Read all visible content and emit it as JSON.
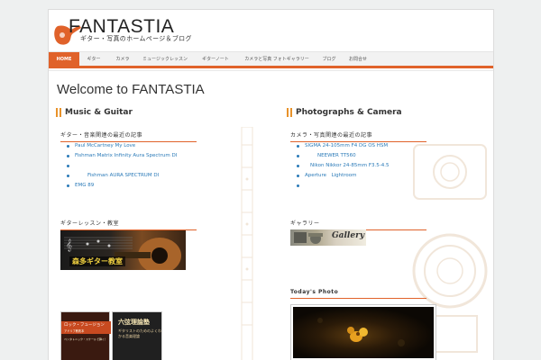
{
  "site": {
    "title": "FANTASTIA",
    "tagline": "ギター・写真のホームページ＆ブログ"
  },
  "nav": {
    "items": [
      {
        "label": "HOME",
        "active": true
      },
      {
        "label": "ギター",
        "active": false
      },
      {
        "label": "カメラ",
        "active": false
      },
      {
        "label": "ミュージックレッスン",
        "active": false
      },
      {
        "label": "ギターノート",
        "active": false
      },
      {
        "label": "カメラと写真 フォトギャラリー",
        "active": false
      },
      {
        "label": "ブログ",
        "active": false
      },
      {
        "label": "お問合せ",
        "active": false
      }
    ]
  },
  "welcome": "Welcome to FANTASTIA",
  "music": {
    "title": "Music & Guitar",
    "widget_title": "ギター・音楽関連の最近の記事",
    "links": [
      "Paul McCartney My Love",
      "Fishman Matrix Infinity Aura Spectrum DI",
      "",
      "Fishman AURA SPECTRUM DI",
      "EMG 89"
    ],
    "lesson_widget_title": "ギターレッスン・教室",
    "lesson_banner": "森多ギター教室"
  },
  "photo": {
    "title": "Photographs & Camera",
    "widget_title": "カメラ・写真関連の最近の記事",
    "links": [
      "SIGMA 24-105mm F4 DG OS HSM",
      "NEEWER TT560",
      "Nikon Nikkor 24-85mm F3.5-4.5",
      "Aperture　Lightroom",
      ""
    ],
    "gallery_widget_title": "ギャラリー",
    "gallery_label": "Gallery",
    "today_title": "Today's Photo"
  },
  "books": {
    "book1_title": "ロック・フュージョン",
    "book1_sub": "アドリブ教則本",
    "book1_caption": "ペンタトニック・スケールで弾く！",
    "book2_title": "六弦理論塾",
    "book2_sub": "ギタリストのためのよくわかる音楽理論"
  },
  "colors": {
    "accent": "#e0622a",
    "link": "#2a7ab8"
  }
}
